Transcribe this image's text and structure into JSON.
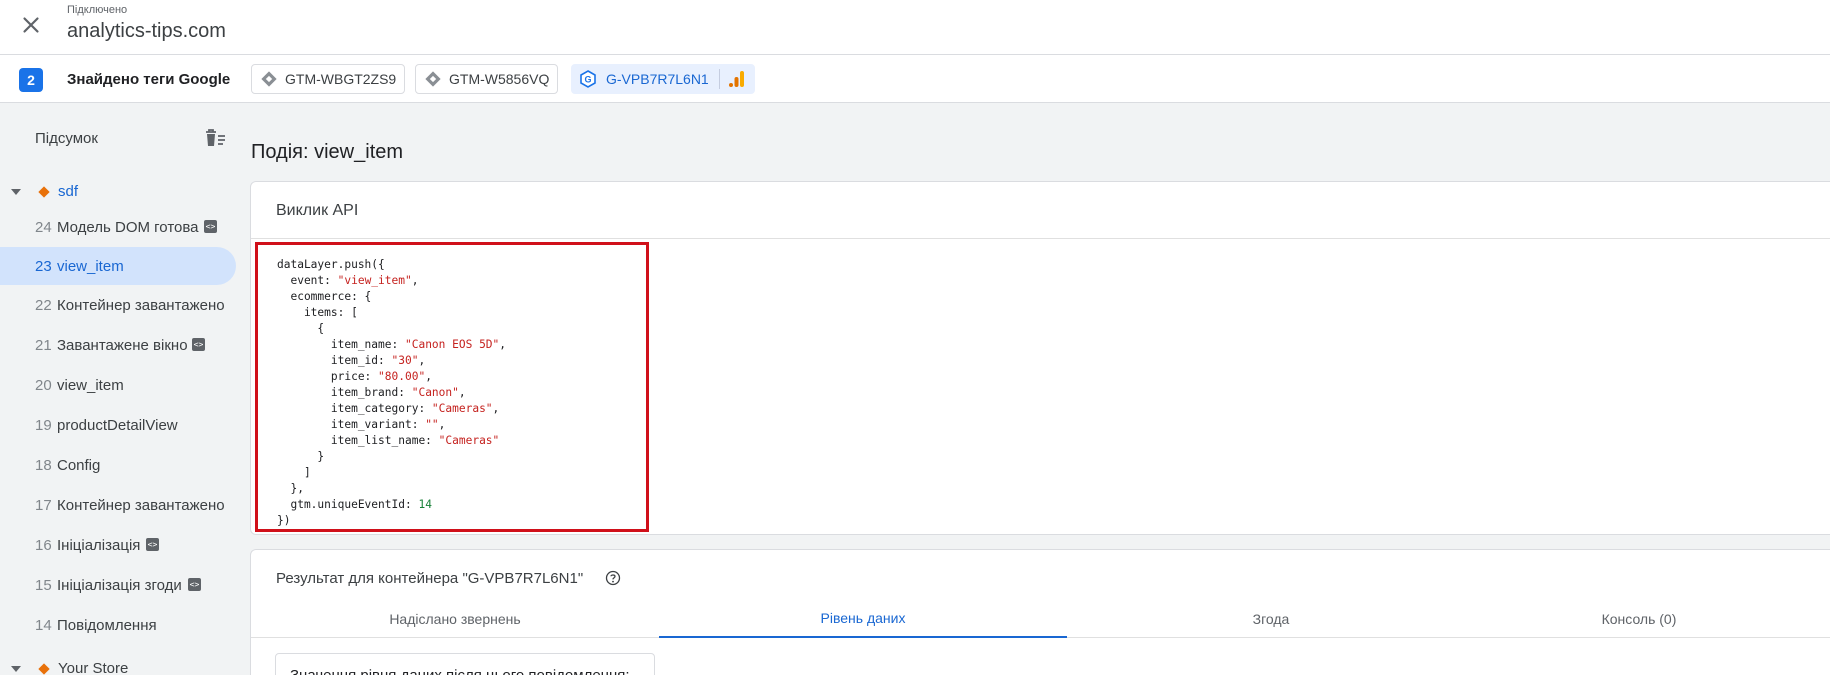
{
  "header": {
    "connected_label": "Підключено",
    "site_name": "analytics-tips.com"
  },
  "tags_bar": {
    "count": "2",
    "label": "Знайдено теги Google",
    "chips": [
      {
        "label": "GTM-WBGT2ZS9",
        "icon": "gtm-icon"
      },
      {
        "label": "GTM-W5856VQ",
        "icon": "gtm-icon"
      },
      {
        "label": "G-VPB7R7L6N1",
        "icon": "google-tag-icon",
        "active": true
      }
    ]
  },
  "sidebar": {
    "summary_label": "Підсумок",
    "groups": [
      {
        "label": "sdf"
      },
      {
        "label": "Your Store"
      }
    ],
    "events": [
      {
        "num": "24",
        "label": "Модель DOM готова",
        "code_badge": true
      },
      {
        "num": "23",
        "label": "view_item",
        "selected": true
      },
      {
        "num": "22",
        "label": "Контейнер завантажено"
      },
      {
        "num": "21",
        "label": "Завантажене вікно",
        "code_badge": true
      },
      {
        "num": "20",
        "label": "view_item"
      },
      {
        "num": "19",
        "label": "productDetailView"
      },
      {
        "num": "18",
        "label": "Config"
      },
      {
        "num": "17",
        "label": "Контейнер завантажено"
      },
      {
        "num": "16",
        "label": "Ініціалізація",
        "code_badge": true
      },
      {
        "num": "15",
        "label": "Ініціалізація згоди",
        "code_badge": true
      },
      {
        "num": "14",
        "label": "Повідомлення"
      }
    ],
    "code_badge_glyph": "<>"
  },
  "main": {
    "event_title": "Подія: view_item",
    "api_card_title": "Виклик API",
    "code": {
      "line1": "dataLayer.push({",
      "event_key": "  event: ",
      "event_val": "\"view_item\"",
      "ecommerce": "  ecommerce: {",
      "items": "    items: [",
      "open": "      {",
      "item_name_key": "        item_name: ",
      "item_name_val": "\"Canon EOS 5D\"",
      "item_id_key": "        item_id: ",
      "item_id_val": "\"30\"",
      "price_key": "        price: ",
      "price_val": "\"80.00\"",
      "item_brand_key": "        item_brand: ",
      "item_brand_val": "\"Canon\"",
      "item_category_key": "        item_category: ",
      "item_category_val": "\"Cameras\"",
      "item_variant_key": "        item_variant: ",
      "item_variant_val": "\"\"",
      "item_list_name_key": "        item_list_name: ",
      "item_list_name_val": "\"Cameras\"",
      "close_obj": "      }",
      "close_arr": "    ]",
      "close_ecom": "  },",
      "gtm_key": "  gtm.uniqueEventId: ",
      "gtm_val": "14",
      "end": "})"
    },
    "result_title": "Результат для контейнера \"G-VPB7R7L6N1\"",
    "tabs": [
      {
        "label": "Надіслано звернень"
      },
      {
        "label": "Рівень даних",
        "active": true
      },
      {
        "label": "Згода"
      },
      {
        "label": "Консоль (0)"
      }
    ],
    "data_layer_note": "Значення рівня даних після цього повідомлення:"
  },
  "colors": {
    "accent": "#1a73e8",
    "highlight_border": "#d0101a",
    "selected_bg": "#d2e3fc",
    "diamond": "#e8710a"
  }
}
